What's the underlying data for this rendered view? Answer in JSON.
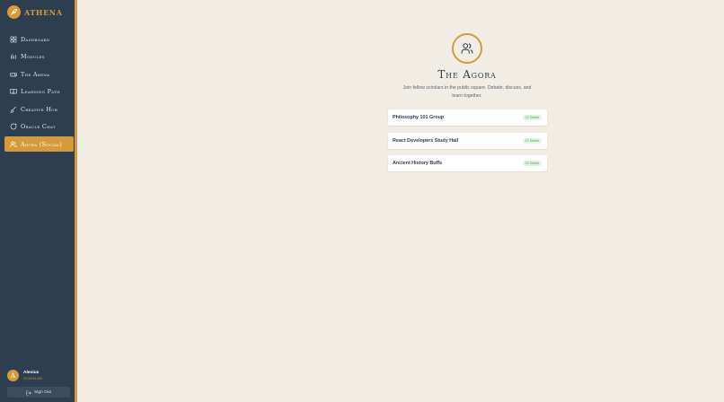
{
  "brand": {
    "name": "ATHENA",
    "logo_icon": "feather-icon",
    "accent": "#d59a39"
  },
  "sidebar": {
    "items": [
      {
        "label": "Dashboard",
        "icon": "dashboard-grid-icon"
      },
      {
        "label": "Modules",
        "icon": "modules-bars-icon"
      },
      {
        "label": "The Arena",
        "icon": "arena-gamepad-icon"
      },
      {
        "label": "Learning Path",
        "icon": "book-icon"
      },
      {
        "label": "Creative Hub",
        "icon": "brush-icon"
      },
      {
        "label": "Oracle Chat",
        "icon": "chat-bubble-icon"
      },
      {
        "label": "Agora (Social)",
        "icon": "users-icon",
        "active": true
      }
    ]
  },
  "user": {
    "initial": "A",
    "name": "Aleoius",
    "role": "SCHOLAR"
  },
  "signout": {
    "label": "Sign Out",
    "icon": "logout-icon"
  },
  "hero": {
    "icon": "users-icon",
    "title": "The Agora",
    "subtitle": "Join fellow scholars in the public square. Debate, discuss, and learn together."
  },
  "rooms": [
    {
      "name": "Philosophy 101 Group",
      "online": "12 Online"
    },
    {
      "name": "React Developers Study Hall",
      "online": "17 Online"
    },
    {
      "name": "Ancient History Buffs",
      "online": "22 Online"
    }
  ],
  "colors": {
    "sidebar": "#2d3e50",
    "background": "#f2ede4",
    "online_green": "#3d9a4a"
  }
}
